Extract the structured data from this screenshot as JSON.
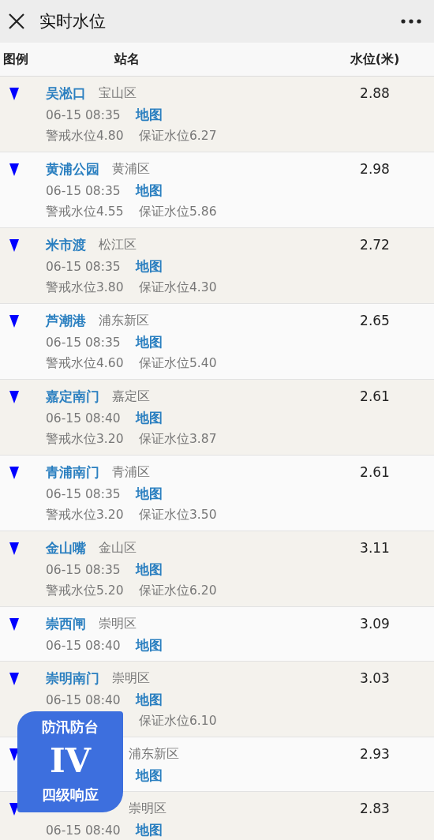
{
  "title_bar": {
    "title": "实时水位"
  },
  "table": {
    "columns": [
      "图例",
      "站名",
      "水位(米)"
    ],
    "rows": [
      {
        "name": "吴淞口",
        "district": "宝山区",
        "time": "06-15 08:35",
        "map": "地图",
        "warning": "警戒水位4.80",
        "guarantee": "保证水位6.27",
        "level": "2.88"
      },
      {
        "name": "黄浦公园",
        "district": "黄浦区",
        "time": "06-15 08:35",
        "map": "地图",
        "warning": "警戒水位4.55",
        "guarantee": "保证水位5.86",
        "level": "2.98"
      },
      {
        "name": "米市渡",
        "district": "松江区",
        "time": "06-15 08:35",
        "map": "地图",
        "warning": "警戒水位3.80",
        "guarantee": "保证水位4.30",
        "level": "2.72"
      },
      {
        "name": "芦潮港",
        "district": "浦东新区",
        "time": "06-15 08:35",
        "map": "地图",
        "warning": "警戒水位4.60",
        "guarantee": "保证水位5.40",
        "level": "2.65"
      },
      {
        "name": "嘉定南门",
        "district": "嘉定区",
        "time": "06-15 08:40",
        "map": "地图",
        "warning": "警戒水位3.20",
        "guarantee": "保证水位3.87",
        "level": "2.61"
      },
      {
        "name": "青浦南门",
        "district": "青浦区",
        "time": "06-15 08:35",
        "map": "地图",
        "warning": "警戒水位3.20",
        "guarantee": "保证水位3.50",
        "level": "2.61"
      },
      {
        "name": "金山嘴",
        "district": "金山区",
        "time": "06-15 08:35",
        "map": "地图",
        "warning": "警戒水位5.20",
        "guarantee": "保证水位6.20",
        "level": "3.11"
      },
      {
        "name": "崇西闸",
        "district": "崇明区",
        "time": "06-15 08:40",
        "map": "地图",
        "level": "3.09"
      },
      {
        "name": "崇明南门",
        "district": "崇明区",
        "time": "06-15 08:40",
        "map": "地图",
        "guarantee": "保证水位6.10",
        "level": "3.03"
      },
      {
        "district": "浦东新区",
        "map": "地图",
        "level": "2.93"
      },
      {
        "district": "崇明区",
        "time": "06-15 08:40",
        "map": "地图",
        "level": "2.83"
      }
    ]
  },
  "badge": {
    "top": "防汛防台",
    "numeral": "IV",
    "bottom": "四级响应"
  }
}
